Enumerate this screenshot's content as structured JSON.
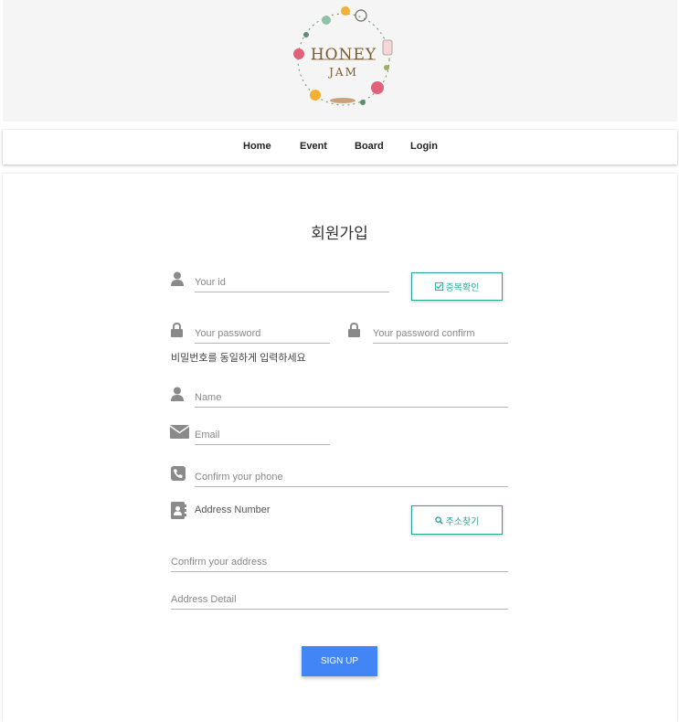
{
  "logo": {
    "line1": "HONEY",
    "line2": "JAM"
  },
  "nav": {
    "items": [
      "Home",
      "Event",
      "Board",
      "Login"
    ]
  },
  "form": {
    "title": "회원가입",
    "id_placeholder": "Your id",
    "check_button": "중복확인",
    "password_placeholder": "Your password",
    "password_confirm_placeholder": "Your password confirm",
    "password_hint": "비밀번호를 동일하게 입력하세요",
    "name_placeholder": "Name",
    "email_placeholder": "Email",
    "phone_placeholder": "Confirm your phone",
    "address_number_label": "Address Number",
    "address_search_button": "주소찾기",
    "address_confirm_placeholder": "Confirm your address",
    "address_detail_placeholder": "Address Detail",
    "signup_button": "SIGN UP"
  },
  "colors": {
    "accent": "#26a69a",
    "primary": "#4285f4",
    "icon": "#8a8a8a"
  }
}
